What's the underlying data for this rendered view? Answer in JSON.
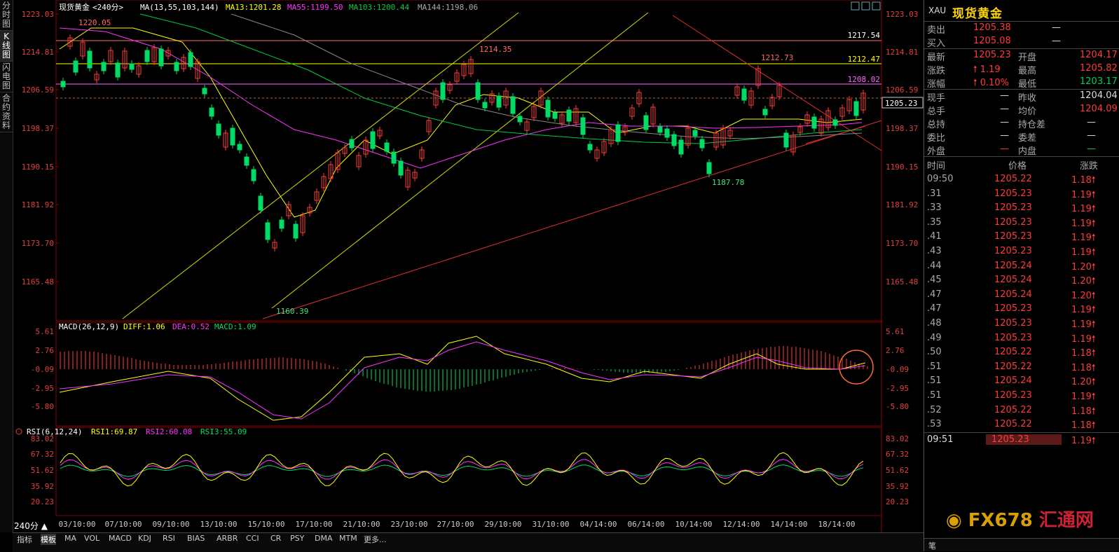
{
  "header": {
    "symbol": "现货黄金",
    "period": "<240分>",
    "ma_params": "MA(13,55,103,144)",
    "ma13": "MA13:1201.28",
    "ma55": "MA55:1199.50",
    "ma103": "MA103:1200.44",
    "ma144": "MA144:1198.06"
  },
  "macd": {
    "params": "MACD(26,12,9)",
    "diff": "DIFF:1.06",
    "dea": "DEA:0.52",
    "macd": "MACD:1.09",
    "ticks": [
      "5.61",
      "2.76",
      "-0.09",
      "-2.95",
      "-5.80"
    ]
  },
  "rsi": {
    "params": "RSI(6,12,24)",
    "rsi1": "RSI1:69.87",
    "rsi2": "RSI2:60.08",
    "rsi3": "RSI3:55.09",
    "ticks": [
      "83.02",
      "67.32",
      "51.62",
      "35.92",
      "20.23"
    ]
  },
  "price_axis": [
    "1223.03",
    "1214.81",
    "1206.59",
    "1198.37",
    "1190.15",
    "1181.92",
    "1173.70",
    "1165.48"
  ],
  "current_price_tag": "1205.23",
  "annotations": {
    "high1": "1220.05",
    "high2": "1214.35",
    "high3": "1212.73",
    "low1": "1160.39",
    "low2": "1187.78",
    "line1": "1217.54",
    "line2": "1212.47",
    "line3": "1208.02"
  },
  "date_axis": [
    "03/10:00",
    "07/10:00",
    "09/10:00",
    "13/10:00",
    "15/10:00",
    "17/10:00",
    "21/10:00",
    "23/10:00",
    "27/10:00",
    "29/10:00",
    "31/10:00",
    "04/14:00",
    "06/14:00",
    "10/14:00",
    "12/14:00",
    "14/14:00",
    "18/14:00"
  ],
  "period_button": "240分 ▲",
  "left_nav": [
    "分时图",
    "K线图",
    "闪电图",
    "合约资料"
  ],
  "bottom_tabs": [
    "指标",
    "模板",
    "MA",
    "VOL",
    "MACD",
    "KDJ",
    "RSI",
    "BIAS",
    "ARBR",
    "CCI",
    "CR",
    "PSY",
    "DMA",
    "MTM",
    "更多..."
  ],
  "quote_panel": {
    "code": "XAU",
    "name": "现货黄金",
    "sell_label": "卖出",
    "sell": "1205.38",
    "sell_vol": "—",
    "buy_label": "买入",
    "buy": "1205.08",
    "buy_vol": "—",
    "last_label": "最新",
    "last": "1205.23",
    "open_label": "开盘",
    "open": "1204.17",
    "chg_label": "涨跌",
    "chg": "1.19",
    "high_label": "最高",
    "high": "1205.82",
    "pct_label": "涨幅",
    "pct": "0.10%",
    "low_label": "最低",
    "low": "1203.17",
    "curvol_label": "现手",
    "curvol": "—",
    "prevclose_label": "昨收",
    "prevclose": "1204.04",
    "totvol_label": "总手",
    "totvol": "—",
    "avg_label": "均价",
    "avg": "1204.09",
    "oi_label": "总持",
    "oi": "—",
    "oichg_label": "持仓差",
    "oichg": "—",
    "ratio_label": "委比",
    "ratio": "—",
    "diff_label": "委差",
    "diffv": "—",
    "outer_label": "外盘",
    "outer": "—",
    "inner_label": "内盘",
    "inner": "—",
    "tick_header": [
      "时间",
      "价格",
      "涨跌"
    ],
    "ticks": [
      [
        "09:50",
        "1205.22",
        "1.18"
      ],
      [
        ".31",
        "1205.23",
        "1.19"
      ],
      [
        ".33",
        "1205.23",
        "1.19"
      ],
      [
        ".35",
        "1205.23",
        "1.19"
      ],
      [
        ".41",
        "1205.23",
        "1.19"
      ],
      [
        ".43",
        "1205.23",
        "1.19"
      ],
      [
        ".44",
        "1205.24",
        "1.20"
      ],
      [
        ".45",
        "1205.24",
        "1.20"
      ],
      [
        ".47",
        "1205.24",
        "1.20"
      ],
      [
        ".47",
        "1205.23",
        "1.19"
      ],
      [
        ".48",
        "1205.23",
        "1.19"
      ],
      [
        ".49",
        "1205.23",
        "1.19"
      ],
      [
        ".50",
        "1205.22",
        "1.18"
      ],
      [
        ".51",
        "1205.22",
        "1.18"
      ],
      [
        ".51",
        "1205.24",
        "1.20"
      ],
      [
        ".51",
        "1205.23",
        "1.19"
      ],
      [
        ".52",
        "1205.22",
        "1.18"
      ],
      [
        ".53",
        "1205.22",
        "1.18"
      ]
    ],
    "last_tick": [
      "09:51",
      "1205.23",
      "1.19"
    ],
    "footer": "笔"
  },
  "watermark": {
    "a": "FX678",
    "b": "汇通网"
  }
}
